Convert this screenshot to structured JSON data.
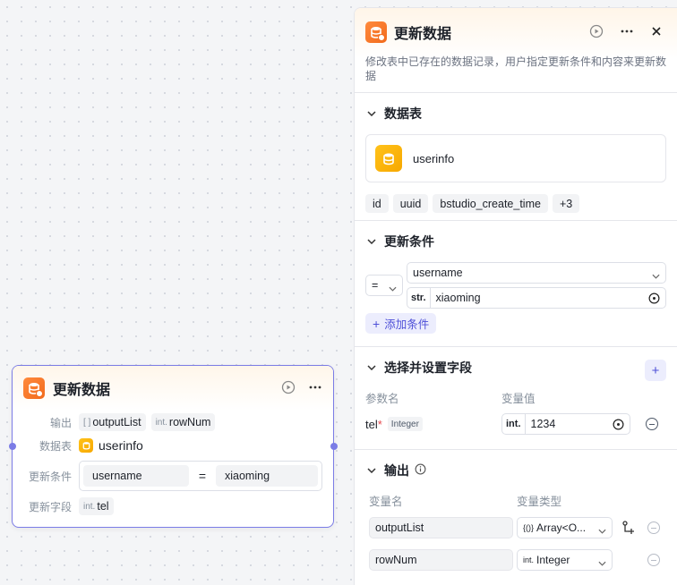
{
  "node": {
    "title": "更新数据",
    "output_label": "输出",
    "outputs": [
      {
        "type": "[ ]",
        "name": "outputList"
      },
      {
        "type": "int.",
        "name": "rowNum"
      }
    ],
    "table_label": "数据表",
    "table_name": "userinfo",
    "condition_label": "更新条件",
    "condition": {
      "field": "username",
      "op": "=",
      "value": "xiaoming"
    },
    "fields_label": "更新字段",
    "field": {
      "type": "int.",
      "name": "tel"
    }
  },
  "panel": {
    "title": "更新数据",
    "description": "修改表中已存在的数据记录，用户指定更新条件和内容来更新数据",
    "table_section": {
      "title": "数据表",
      "table_name": "userinfo",
      "fields": [
        "id",
        "uuid",
        "bstudio_create_time",
        "+3"
      ]
    },
    "condition_section": {
      "title": "更新条件",
      "operator": "=",
      "field": "username",
      "value_type": "str.",
      "value": "xiaoming",
      "add_label": "添加条件"
    },
    "fields_section": {
      "title": "选择并设置字段",
      "col_param": "参数名",
      "col_value": "变量值",
      "param_name": "tel",
      "required": "*",
      "param_type": "Integer",
      "value_type": "int.",
      "value": "1234"
    },
    "output_section": {
      "title": "输出",
      "col_name": "变量名",
      "col_type": "变量类型",
      "rows": [
        {
          "name": "outputList",
          "type_prefix": "{()}",
          "type": "Array<O..."
        },
        {
          "name": "rowNum",
          "type_prefix": "int.",
          "type": "Integer"
        }
      ]
    }
  },
  "colors": {
    "accent": "#4e50d8",
    "node_border": "#7b7ce6",
    "db_orange": "#f26b1d",
    "db_yellow": "#f7a800",
    "required": "#e5484d"
  }
}
